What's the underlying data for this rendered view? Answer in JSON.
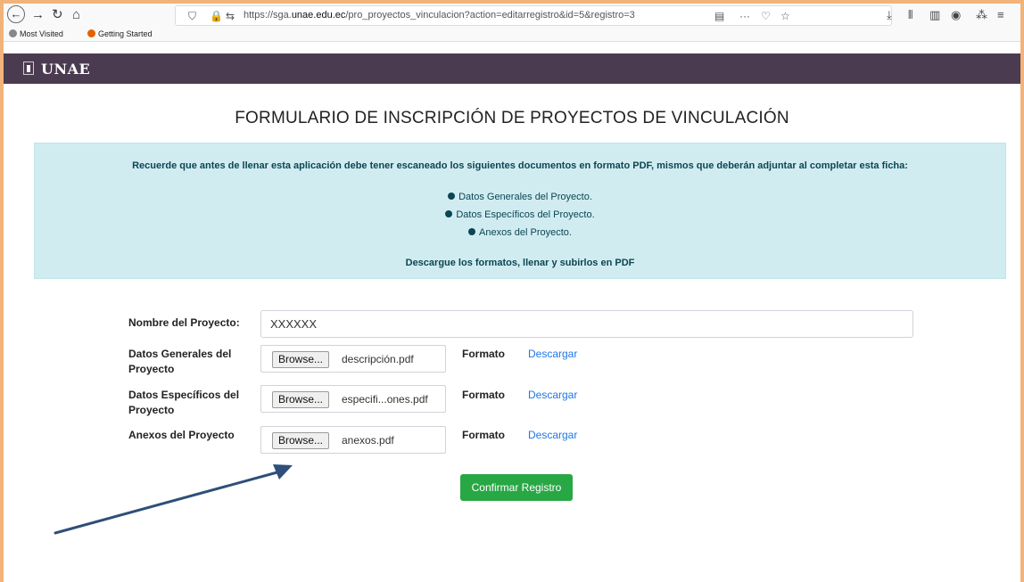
{
  "browser": {
    "url_prefix": "https://sga.",
    "url_domain": "unae.edu.ec",
    "url_path": "/pro_proyectos_vinculacion?action=editarregistro&id=5&registro=3",
    "bookmarks": [
      "Most Visited",
      "Getting Started"
    ]
  },
  "site": {
    "logo_text": "UNAE"
  },
  "page": {
    "title": "FORMULARIO DE INSCRIPCIÓN DE PROYECTOS DE VINCULACIÓN",
    "alert_intro": "Recuerde que antes de llenar esta aplicación debe tener escaneado los siguientes documentos en formato PDF, mismos que deberán adjuntar al completar esta ficha:",
    "alert_items": [
      "Datos Generales del Proyecto.",
      "Datos Específicos del Proyecto.",
      "Anexos del Proyecto."
    ],
    "alert_footer": "Descargue los formatos, llenar y subirlos en PDF"
  },
  "form": {
    "name_label": "Nombre del Proyecto:",
    "name_value": "XXXXXX",
    "browse_label": "Browse...",
    "formato_label": "Formato",
    "descargar_label": "Descargar",
    "rows": [
      {
        "label_l1": "Datos Generales del",
        "label_l2": "Proyecto",
        "file": "descripción.pdf"
      },
      {
        "label_l1": "Datos Específicos del",
        "label_l2": "Proyecto",
        "file": "especifi...ones.pdf"
      },
      {
        "label_l1": "Anexos del Proyecto",
        "label_l2": "",
        "file": "anexos.pdf"
      }
    ],
    "confirm_label": "Confirmar Registro"
  },
  "colors": {
    "header_bg": "#4b3b50",
    "alert_bg": "#d1ecf1",
    "confirm_bg": "#28a745",
    "link": "#1e76e8",
    "arrow": "#2e4f79",
    "frame": "#f2b37a"
  },
  "icons": [
    "back-icon",
    "forward-icon",
    "reload-icon",
    "home-icon",
    "shield-icon",
    "lock-icon",
    "reader-icon",
    "more-icon",
    "pocket-icon",
    "star-icon",
    "download-icon",
    "library-icon",
    "sidebar-icon",
    "account-icon",
    "extension-icon",
    "menu-icon"
  ]
}
